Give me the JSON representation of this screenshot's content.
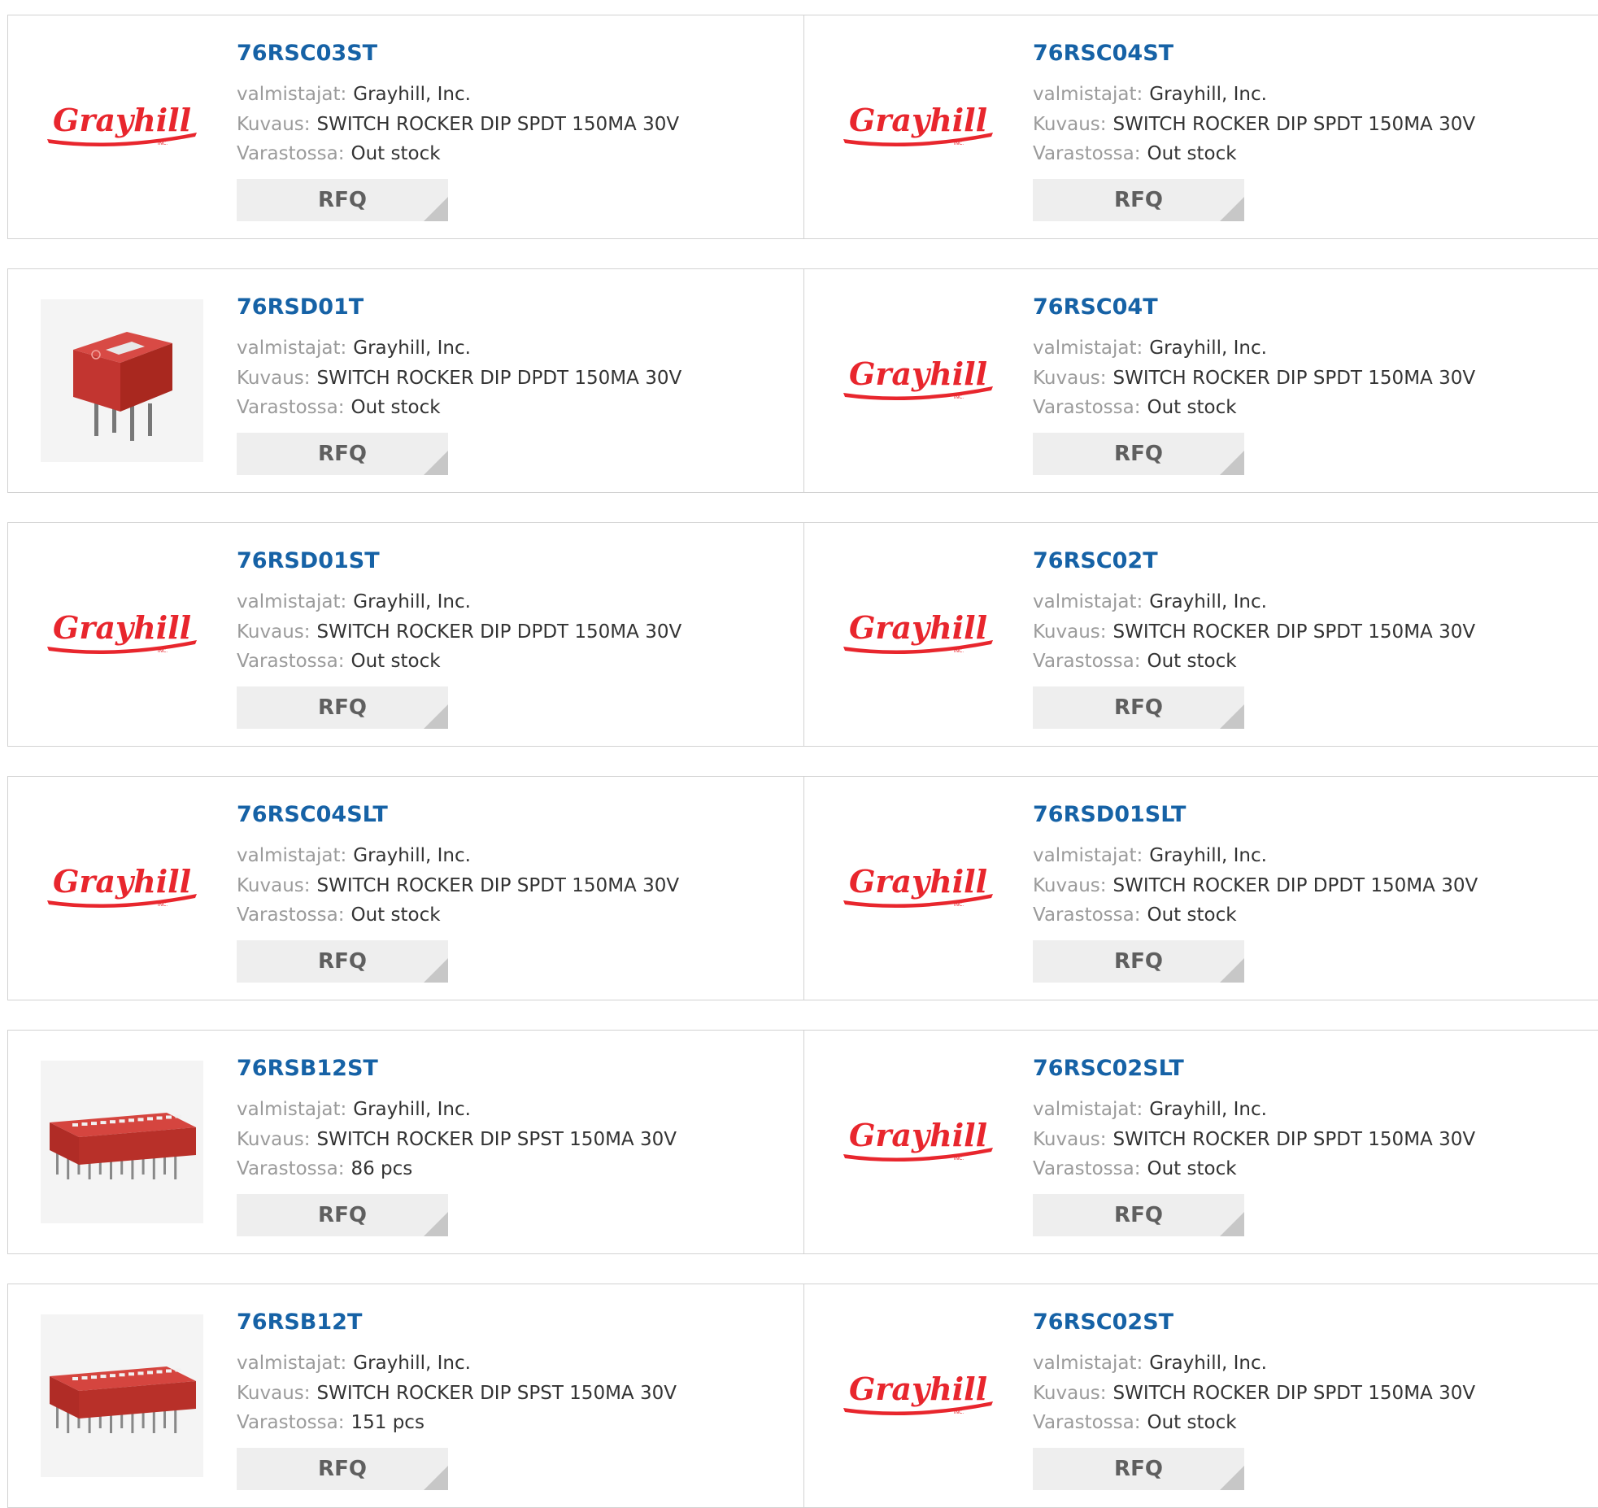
{
  "labels": {
    "manufacturer": "valmistajat:",
    "description": "Kuvaus:",
    "stock": "Varastossa:",
    "rfq": "RFQ"
  },
  "brand": {
    "logo_text": "Grayhill",
    "logo_sub": "INC.",
    "color": "#e8262d"
  },
  "colors": {
    "link": "#1662a6",
    "label": "#9b9b9b",
    "value": "#333333",
    "button_bg": "#eeeeee",
    "border": "#d2d2d2"
  },
  "products": [
    {
      "part": "76RSC03ST",
      "manufacturer": "Grayhill, Inc.",
      "description": "SWITCH ROCKER DIP SPDT 150MA 30V",
      "stock": "Out stock",
      "image": "grayhill-logo"
    },
    {
      "part": "76RSC04ST",
      "manufacturer": "Grayhill, Inc.",
      "description": "SWITCH ROCKER DIP SPDT 150MA 30V",
      "stock": "Out stock",
      "image": "grayhill-logo"
    },
    {
      "part": "76RSD01T",
      "manufacturer": "Grayhill, Inc.",
      "description": "SWITCH ROCKER DIP DPDT 150MA 30V",
      "stock": "Out stock",
      "image": "dip-switch-single"
    },
    {
      "part": "76RSC04T",
      "manufacturer": "Grayhill, Inc.",
      "description": "SWITCH ROCKER DIP SPDT 150MA 30V",
      "stock": "Out stock",
      "image": "grayhill-logo"
    },
    {
      "part": "76RSD01ST",
      "manufacturer": "Grayhill, Inc.",
      "description": "SWITCH ROCKER DIP DPDT 150MA 30V",
      "stock": "Out stock",
      "image": "grayhill-logo"
    },
    {
      "part": "76RSC02T",
      "manufacturer": "Grayhill, Inc.",
      "description": "SWITCH ROCKER DIP SPDT 150MA 30V",
      "stock": "Out stock",
      "image": "grayhill-logo"
    },
    {
      "part": "76RSC04SLT",
      "manufacturer": "Grayhill, Inc.",
      "description": "SWITCH ROCKER DIP SPDT 150MA 30V",
      "stock": "Out stock",
      "image": "grayhill-logo"
    },
    {
      "part": "76RSD01SLT",
      "manufacturer": "Grayhill, Inc.",
      "description": "SWITCH ROCKER DIP DPDT 150MA 30V",
      "stock": "Out stock",
      "image": "grayhill-logo"
    },
    {
      "part": "76RSB12ST",
      "manufacturer": "Grayhill, Inc.",
      "description": "SWITCH ROCKER DIP SPST 150MA 30V",
      "stock": "86 pcs",
      "image": "dip-switch-12pos"
    },
    {
      "part": "76RSC02SLT",
      "manufacturer": "Grayhill, Inc.",
      "description": "SWITCH ROCKER DIP SPDT 150MA 30V",
      "stock": "Out stock",
      "image": "grayhill-logo"
    },
    {
      "part": "76RSB12T",
      "manufacturer": "Grayhill, Inc.",
      "description": "SWITCH ROCKER DIP SPST 150MA 30V",
      "stock": "151 pcs",
      "image": "dip-switch-12pos"
    },
    {
      "part": "76RSC02ST",
      "manufacturer": "Grayhill, Inc.",
      "description": "SWITCH ROCKER DIP SPDT 150MA 30V",
      "stock": "Out stock",
      "image": "grayhill-logo"
    }
  ]
}
